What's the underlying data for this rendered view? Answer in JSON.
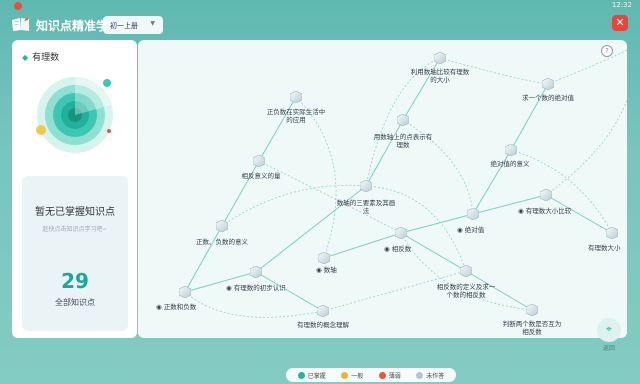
{
  "status": {
    "time": "12:32"
  },
  "header": {
    "title": "知识点精准学",
    "grade": "初一上册"
  },
  "sidebar": {
    "subject": "有理数",
    "stats_title": "暂无已掌握知识点",
    "stats_subtitle": "赶快点击知识点学习吧~",
    "count": "29",
    "count_label": "全部知识点"
  },
  "map": {
    "help": "?",
    "back": "返回",
    "nodes": [
      {
        "id": "n1",
        "label": "利用数轴比较有理数的大小"
      },
      {
        "id": "n2",
        "label": "求一个数的绝对值"
      },
      {
        "id": "n3",
        "label": "正负数在实际生活中的应用"
      },
      {
        "id": "n4",
        "label": "用数轴上的点表示有理数"
      },
      {
        "id": "n5",
        "label": "相反意义的量"
      },
      {
        "id": "n6",
        "label": "绝对值的意义"
      },
      {
        "id": "n7",
        "label": "数轴的三要素及其画法"
      },
      {
        "id": "n8",
        "label": "有理数大小比较"
      },
      {
        "id": "n9",
        "label": "绝对值"
      },
      {
        "id": "n10",
        "label": "正数、负数的意义"
      },
      {
        "id": "n11",
        "label": "相反数"
      },
      {
        "id": "n12",
        "label": "有理数大小"
      },
      {
        "id": "n13",
        "label": "数轴"
      },
      {
        "id": "n14",
        "label": "有理数的初步认识"
      },
      {
        "id": "n15",
        "label": "相反数的定义及求一个数的相反数"
      },
      {
        "id": "n16",
        "label": "正数和负数"
      },
      {
        "id": "n17",
        "label": "有理数的概念理解"
      },
      {
        "id": "n18",
        "label": "判断两个数是否互为相反数"
      }
    ]
  },
  "legend": [
    {
      "label": "已掌握",
      "color": "#27b39f"
    },
    {
      "label": "一般",
      "color": "#f2b23a"
    },
    {
      "label": "薄弱",
      "color": "#e9563f"
    },
    {
      "label": "未作答",
      "color": "#b8c4cc"
    }
  ]
}
